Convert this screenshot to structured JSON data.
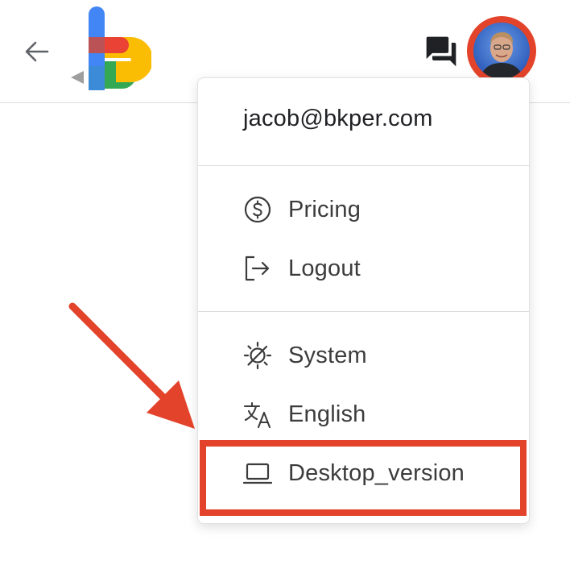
{
  "header": {
    "back_icon": "arrow-left-icon",
    "logo_icon": "bkper-logo",
    "chat_icon": "forum-icon",
    "avatar_icon": "user-avatar"
  },
  "menu": {
    "email": "jacob@bkper.com",
    "items": [
      {
        "label": "Pricing",
        "icon": "dollar-circle-icon"
      },
      {
        "label": "Logout",
        "icon": "logout-icon"
      },
      {
        "label": "System",
        "icon": "theme-system-icon"
      },
      {
        "label": "English",
        "icon": "translate-icon"
      },
      {
        "label": "Desktop_version",
        "icon": "laptop-icon"
      }
    ]
  },
  "annotation": {
    "color": "#e3432a"
  }
}
